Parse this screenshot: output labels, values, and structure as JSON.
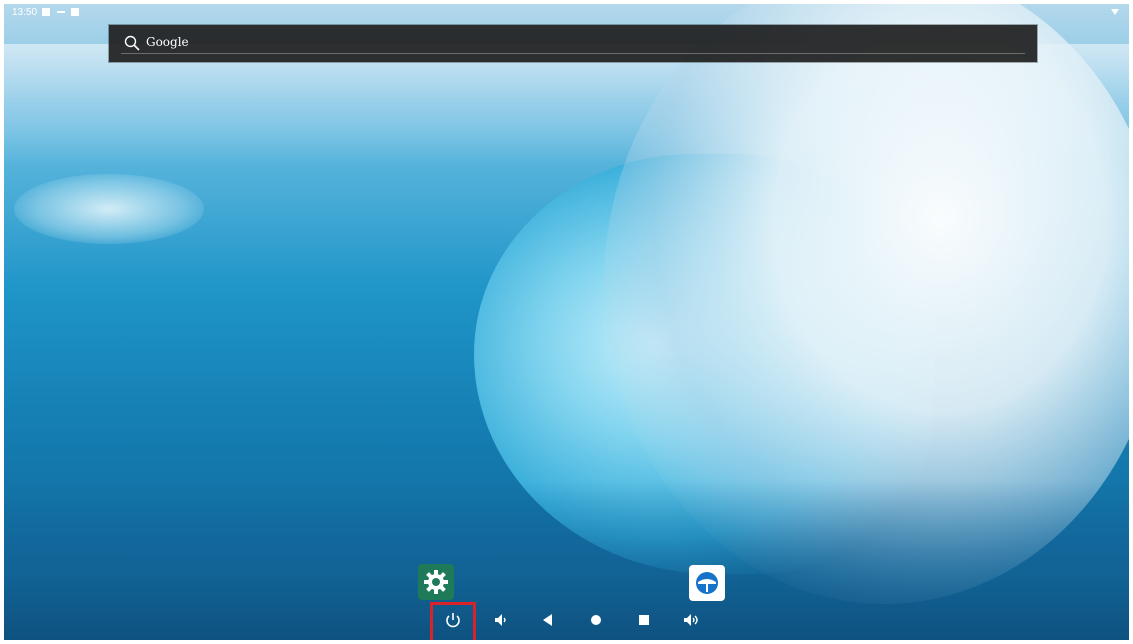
{
  "status_bar": {
    "time": "13:50",
    "icons": [
      "image-icon",
      "minus-icon",
      "a-icon",
      "wifi-icon"
    ]
  },
  "search": {
    "placeholder": "Google",
    "icon": "search-icon"
  },
  "dock": {
    "apps": [
      {
        "name": "settings-app",
        "icon": "gear-icon",
        "color": "#1f7a5a"
      },
      {
        "name": "browser-app",
        "icon": "globe-icon",
        "color": "#ffffff",
        "accent": "#1673c9"
      }
    ]
  },
  "nav_bar": {
    "buttons": [
      "power-icon",
      "volume-down-icon",
      "back-icon",
      "home-icon",
      "recents-icon",
      "volume-up-icon"
    ],
    "highlight_color": "#d8232a"
  }
}
